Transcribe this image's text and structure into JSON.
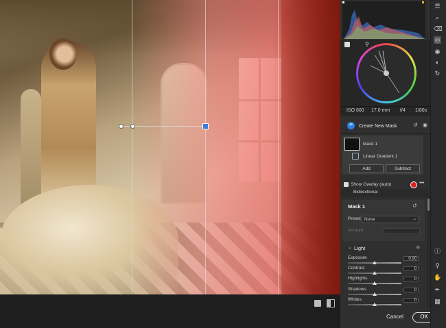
{
  "camera_info": {
    "iso": "ISO 800",
    "focal": "17.0 mm",
    "aperture": "f/4",
    "shutter": "1/80s"
  },
  "masking": {
    "create_label": "Create New Mask",
    "mask_name": "Mask 1",
    "component": "Linear Gradient 1",
    "add_label": "Add",
    "subtract_label": "Subtract"
  },
  "overlay": {
    "label": "Show Overlay (auto)",
    "color": "#e02020",
    "more": "•••"
  },
  "bidirectional": "Bidirectional",
  "mask_panel": {
    "title": "Mask 1",
    "preset_label": "Preset",
    "preset_value": "None",
    "amount_label": "Amount"
  },
  "light": {
    "title": "Light",
    "sliders": [
      {
        "label": "Exposure",
        "value": "0.00",
        "pos": 0.5
      },
      {
        "label": "Contrast",
        "value": "0",
        "pos": 0.5
      },
      {
        "label": "Highlights",
        "value": "0",
        "pos": 0.5
      },
      {
        "label": "Shadows",
        "value": "0",
        "pos": 0.5
      },
      {
        "label": "Whites",
        "value": "0",
        "pos": 0.5
      }
    ]
  },
  "footer": {
    "cancel": "Cancel",
    "ok": "OK"
  },
  "accent": "#2f7fe0"
}
